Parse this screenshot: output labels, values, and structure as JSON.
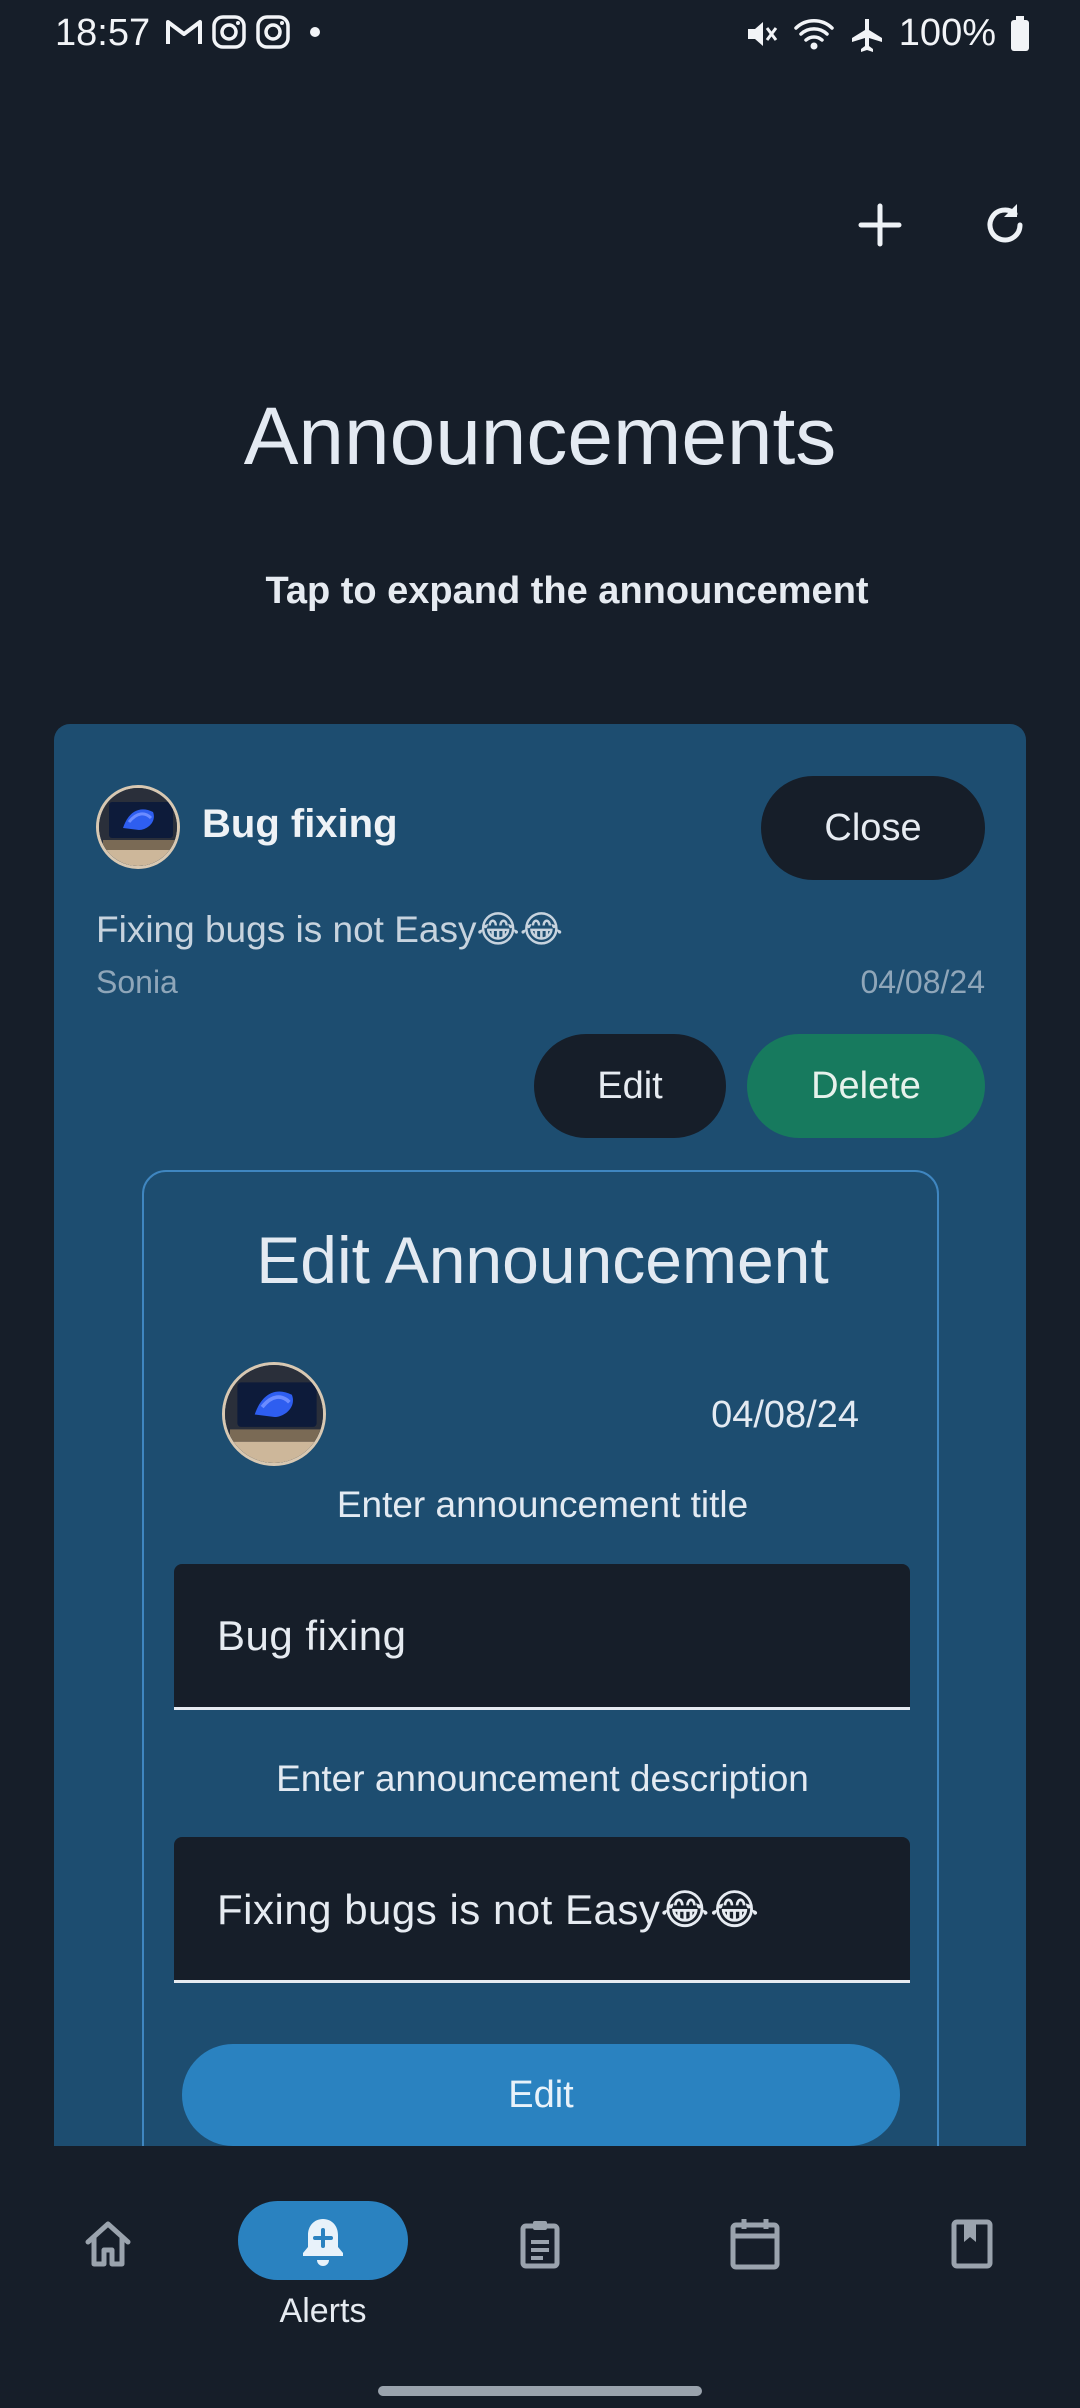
{
  "status_bar": {
    "time": "18:57",
    "battery": "100%",
    "left_icons": [
      "gmail-icon",
      "instagram-icon",
      "instagram-icon",
      "dot-icon"
    ],
    "right_icons": [
      "mute-icon",
      "wifi-icon",
      "airplane-icon",
      "battery-icon"
    ]
  },
  "header": {
    "actions": [
      "add-icon",
      "refresh-icon"
    ],
    "title": "Announcements",
    "subtitle": "Tap to expand the announcement"
  },
  "announcement": {
    "title": "Bug fixing",
    "close_label": "Close",
    "description": "Fixing bugs is not Easy😂😂",
    "author": "Sonia",
    "date": "04/08/24",
    "edit_label": "Edit",
    "delete_label": "Delete"
  },
  "edit_panel": {
    "title": "Edit Announcement",
    "date": "04/08/24",
    "title_label": "Enter announcement title",
    "title_value": "Bug fixing",
    "description_label": "Enter announcement description",
    "description_value": "Fixing bugs is not Easy😂😂",
    "submit_label": "Edit"
  },
  "nav": {
    "items": [
      {
        "icon": "home-icon",
        "label": "",
        "active": false
      },
      {
        "icon": "bell-add-icon",
        "label": "Alerts",
        "active": true
      },
      {
        "icon": "clipboard-icon",
        "label": "",
        "active": false
      },
      {
        "icon": "calendar-icon",
        "label": "",
        "active": false
      },
      {
        "icon": "book-icon",
        "label": "",
        "active": false
      }
    ]
  },
  "colors": {
    "background": "#161e29",
    "card": "#1d4d70",
    "accent": "#2a82c0",
    "delete": "#177a5e"
  }
}
